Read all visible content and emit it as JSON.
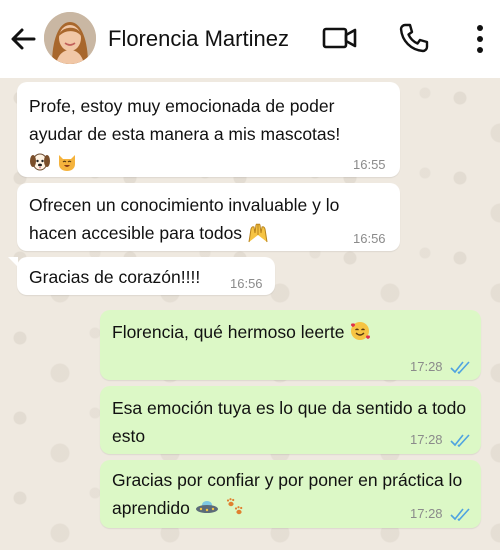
{
  "contact": {
    "name": "Florencia Martinez"
  },
  "messages": [
    {
      "direction": "in",
      "text": "Profe, estoy muy emocionada de poder ayudar de esta manera a mis mascotas!",
      "time": "16:55",
      "emoji": [
        "dog-face-emoji",
        "cat-face-emoji"
      ]
    },
    {
      "direction": "in",
      "text": "Ofrecen un conocimiento invaluable y lo hacen accesible para todos",
      "time": "16:56",
      "emoji": [
        "raised-hands-emoji"
      ]
    },
    {
      "direction": "in",
      "text": "Gracias de corazón!!!!",
      "time": "16:56",
      "emoji": []
    },
    {
      "direction": "out",
      "text": "Florencia, qué hermoso leerte",
      "time": "17:28",
      "emoji": [
        "smiling-face-with-hearts-emoji"
      ],
      "status": "read"
    },
    {
      "direction": "out",
      "text": "Esa emoción tuya es lo que da sentido a todo esto",
      "time": "17:28",
      "emoji": [],
      "status": "read"
    },
    {
      "direction": "out",
      "text": "Gracias por confiar y por poner en práctica lo aprendido",
      "time": "17:28",
      "emoji": [
        "flying-saucer-emoji",
        "paw-prints-emoji"
      ],
      "status": "read"
    }
  ],
  "colors": {
    "outgoing_bubble": "#dcf8c6",
    "incoming_bubble": "#ffffff",
    "read_ticks": "#4fa3e0"
  }
}
